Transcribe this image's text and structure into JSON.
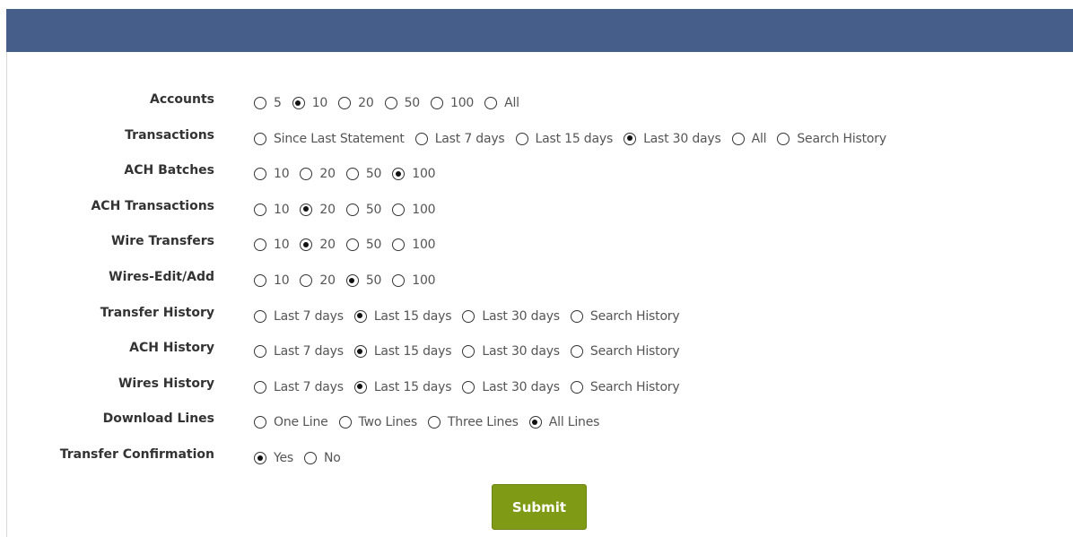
{
  "submit_label": "Submit",
  "rows": [
    {
      "label": "Accounts",
      "options": [
        "5",
        "10",
        "20",
        "50",
        "100",
        "All"
      ],
      "selected": 1
    },
    {
      "label": "Transactions",
      "options": [
        "Since Last Statement",
        "Last 7 days",
        "Last 15 days",
        "Last 30 days",
        "All",
        "Search History"
      ],
      "selected": 3
    },
    {
      "label": "ACH Batches",
      "options": [
        "10",
        "20",
        "50",
        "100"
      ],
      "selected": 3
    },
    {
      "label": "ACH Transactions",
      "options": [
        "10",
        "20",
        "50",
        "100"
      ],
      "selected": 1
    },
    {
      "label": "Wire Transfers",
      "options": [
        "10",
        "20",
        "50",
        "100"
      ],
      "selected": 1
    },
    {
      "label": "Wires-Edit/Add",
      "options": [
        "10",
        "20",
        "50",
        "100"
      ],
      "selected": 2
    },
    {
      "label": "Transfer History",
      "options": [
        "Last 7 days",
        "Last 15 days",
        "Last 30 days",
        "Search History"
      ],
      "selected": 1
    },
    {
      "label": "ACH History",
      "options": [
        "Last 7 days",
        "Last 15 days",
        "Last 30 days",
        "Search History"
      ],
      "selected": 1
    },
    {
      "label": "Wires History",
      "options": [
        "Last 7 days",
        "Last 15 days",
        "Last 30 days",
        "Search History"
      ],
      "selected": 1
    },
    {
      "label": "Download Lines",
      "options": [
        "One Line",
        "Two Lines",
        "Three Lines",
        "All Lines"
      ],
      "selected": 3
    },
    {
      "label": "Transfer Confirmation",
      "options": [
        "Yes",
        "No"
      ],
      "selected": 0
    }
  ]
}
